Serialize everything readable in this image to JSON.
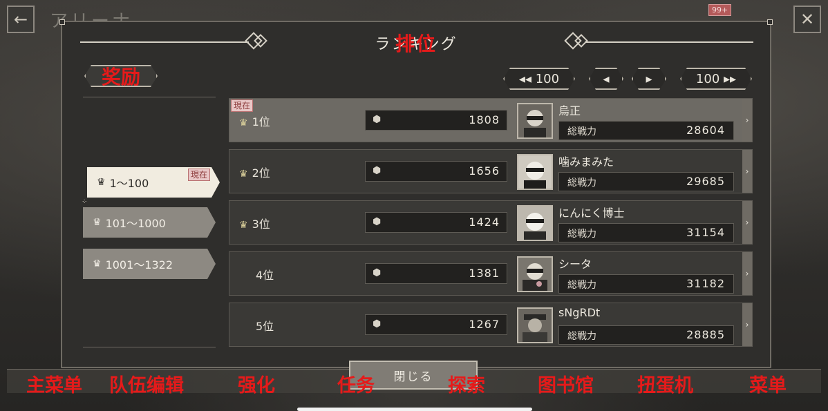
{
  "header": {
    "title": "アリーナ",
    "badge": "99+"
  },
  "modal": {
    "title": "ランキング",
    "title_overlay": "排位",
    "reward_label": "奖励",
    "pagination": {
      "first": "◂◂ 100",
      "prev": "◂",
      "next": "▸",
      "last": "100 ▸▸"
    },
    "current_badge": "現在",
    "power_label": "総戦力",
    "ranges": [
      {
        "label": "1〜100",
        "active": true
      },
      {
        "label": "101〜1000",
        "active": false
      },
      {
        "label": "1001〜1322",
        "active": false
      }
    ],
    "rows": [
      {
        "rank": "1位",
        "crown": true,
        "score": "1808",
        "name": "烏正",
        "power": "28604",
        "current": true
      },
      {
        "rank": "2位",
        "crown": true,
        "score": "1656",
        "name": "噛みまみた",
        "power": "29685",
        "current": false
      },
      {
        "rank": "3位",
        "crown": true,
        "score": "1424",
        "name": "にんにく博士",
        "power": "31154",
        "current": false
      },
      {
        "rank": "4位",
        "crown": false,
        "score": "1381",
        "name": "シータ",
        "power": "31182",
        "current": false
      },
      {
        "rank": "5位",
        "crown": false,
        "score": "1267",
        "name": "sNgRDt",
        "power": "28885",
        "current": false
      }
    ],
    "close_label": "閉じる"
  },
  "bottom_nav": [
    {
      "label": "主菜单"
    },
    {
      "label": "队伍编辑"
    },
    {
      "label": "强化"
    },
    {
      "label": "任务"
    },
    {
      "label": "探索"
    },
    {
      "label": "图书馆"
    },
    {
      "label": "扭蛋机"
    },
    {
      "label": "菜单"
    }
  ],
  "icons": {
    "crown": "♛",
    "cube": "⬢",
    "arrow": "›"
  },
  "colors": {
    "overlay_red": "#e61a1a",
    "active_range": "#f1ece0",
    "current_badge": "#e9c7c7"
  }
}
